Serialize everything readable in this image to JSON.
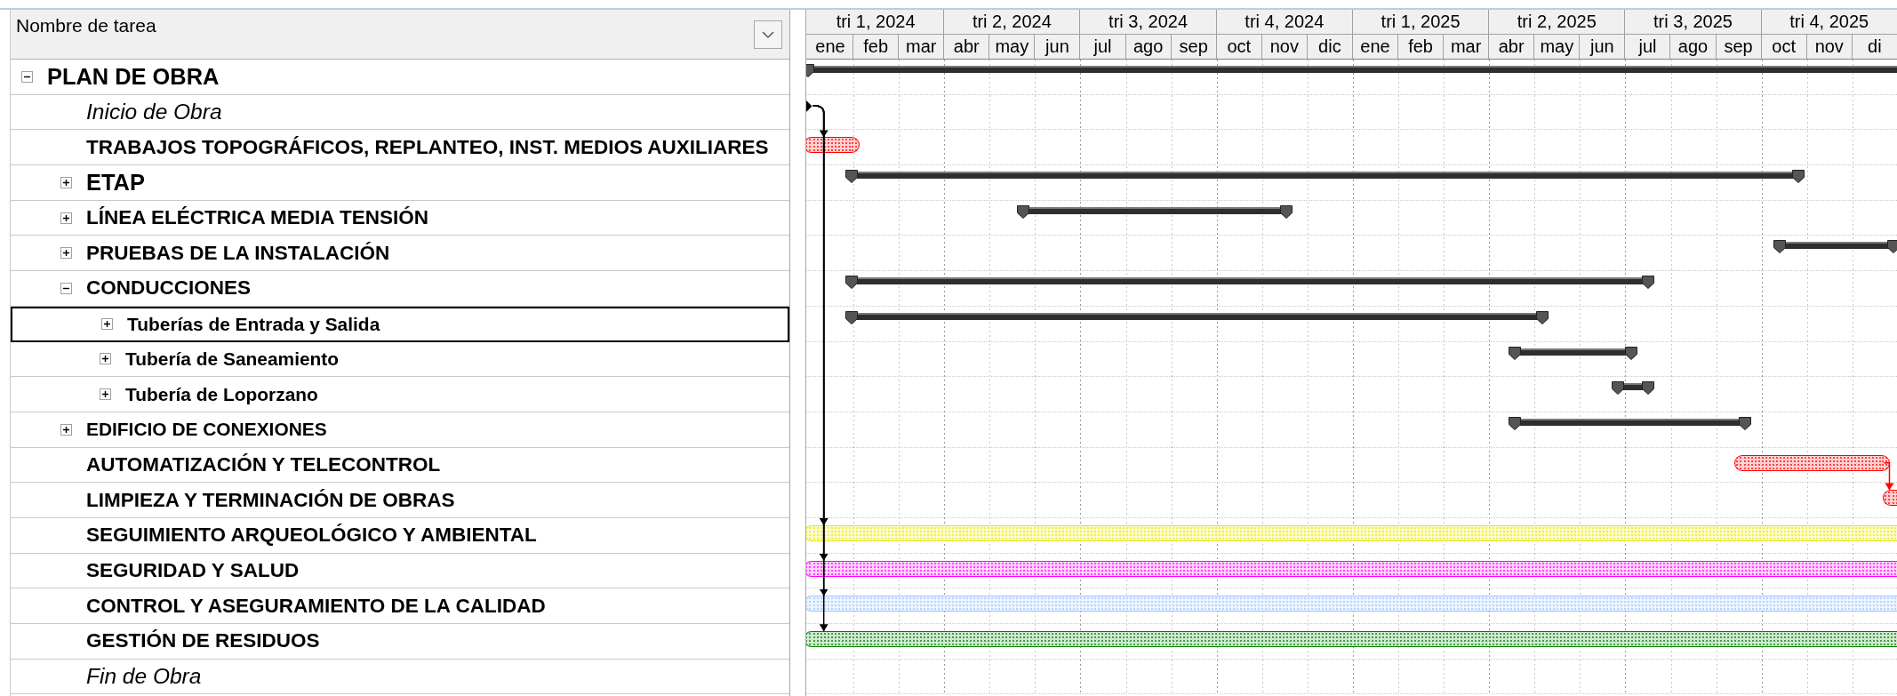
{
  "task_table": {
    "column_header": "Nombre de tarea",
    "tasks": [
      {
        "name": "PLAN DE OBRA",
        "kind": "summary",
        "large": true,
        "small": false,
        "selected": false,
        "expanded": true,
        "bar": {
          "start": {
            "level": 0.002
          }
        },
        "children": [
          {
            "name": "Inicio de Obra",
            "kind": "milestone",
            "large": false,
            "small": false,
            "selected": false,
            "bar": {
              "start": {
                "level": 0.003
              }
            }
          },
          {
            "name": "TRABAJOS TOPOGRÁFICOS, REPLANTEO, INST. MEDIOS AUXILIARES",
            "kind": "task",
            "large": false,
            "small": false,
            "selected": false,
            "bar": {
              "start": {
                "level": 0.002
              },
              "end": {
                "level": 0.0446
              },
              "color": "#ff0000",
              "link_from_start": true,
              "link_from_previous": false
            }
          },
          {
            "name": "ETAP",
            "kind": "summary",
            "large": true,
            "small": false,
            "selected": false,
            "expanded": false,
            "bar": {
              "start": {
                "level": 0.0419
              },
              "end": {
                "level": 0.9086
              }
            }
          },
          {
            "name": "LÍNEA ELÉCTRICA MEDIA TENSIÓN",
            "kind": "summary",
            "large": false,
            "small": false,
            "selected": false,
            "expanded": false,
            "bar": {
              "start": {
                "level": 0.1985
              },
              "end": {
                "level": 0.4398
              }
            }
          },
          {
            "name": "PRUEBAS DE LA INSTALACIÓN",
            "kind": "summary",
            "large": false,
            "small": false,
            "selected": false,
            "expanded": false,
            "bar": {
              "start": {
                "level": 0.8919
              },
              "end": {
                "level": 0.9959
              }
            }
          },
          {
            "name": "CONDUCCIONES",
            "kind": "summary",
            "large": false,
            "small": false,
            "selected": false,
            "expanded": true,
            "bar": {
              "start": {
                "level": 0.0419
              },
              "end": {
                "level": 0.7713
              }
            },
            "children": [
              {
                "name": "Tuberías de Entrada y Salida",
                "kind": "summary",
                "large": false,
                "small": true,
                "selected": true,
                "expanded": false,
                "bar": {
                  "start": {
                    "level": 0.0419
                  },
                  "end": {
                    "level": 0.6743
                  }
                }
              },
              {
                "name": "Tubería de Saneamiento",
                "kind": "summary",
                "large": false,
                "small": true,
                "selected": false,
                "expanded": false,
                "bar": {
                  "start": {
                    "level": 0.6493
                  },
                  "end": {
                    "level": 0.756
                  }
                }
              },
              {
                "name": "Tubería de Loporzano",
                "kind": "summary",
                "large": false,
                "small": true,
                "selected": false,
                "expanded": false,
                "bar": {
                  "start": {
                    "level": 0.7436
                  },
                  "end": {
                    "level": 0.7713
                  }
                }
              }
            ]
          },
          {
            "name": "EDIFICIO DE CONEXIONES",
            "kind": "summary",
            "large": false,
            "small": true,
            "selected": false,
            "expanded": false,
            "bar": {
              "start": {
                "level": 0.6493
              },
              "end": {
                "level": 0.8601
              }
            }
          },
          {
            "name": "AUTOMATIZACIÓN Y TELECONTROL",
            "kind": "task",
            "large": false,
            "small": false,
            "selected": false,
            "bar": {
              "start": {
                "level": 0.8545
              },
              "end": {
                "level": 0.989
              },
              "color": "#ff0000",
              "link_from_start": false,
              "link_from_previous": false
            }
          },
          {
            "name": "LIMPIEZA Y TERMINACIÓN DE OBRAS",
            "kind": "task",
            "large": false,
            "small": false,
            "selected": false,
            "bar": {
              "start": {
                "level": 0.9904
              },
              "color": "#ff0000",
              "link_from_start": false,
              "link_from_previous": true
            }
          },
          {
            "name": "SEGUIMIENTO ARQUEOLÓGICO Y AMBIENTAL",
            "kind": "task",
            "large": false,
            "small": false,
            "selected": false,
            "bar": {
              "start": {
                "level": 0.002
              },
              "color": "#e6e600",
              "link_from_start": true,
              "link_from_previous": false
            }
          },
          {
            "name": "SEGURIDAD Y SALUD",
            "kind": "task",
            "large": false,
            "small": false,
            "selected": false,
            "bar": {
              "start": {
                "level": 0.002
              },
              "color": "#ff00ff",
              "link_from_start": true,
              "link_from_previous": false
            }
          },
          {
            "name": "CONTROL Y ASEGURAMIENTO DE LA CALIDAD",
            "kind": "task",
            "large": false,
            "small": false,
            "selected": false,
            "bar": {
              "start": {
                "level": 0.002
              },
              "color": "#99c2ff",
              "link_from_start": true,
              "link_from_previous": false
            }
          },
          {
            "name": "GESTIÓN DE RESIDUOS",
            "kind": "task",
            "large": false,
            "small": false,
            "selected": false,
            "bar": {
              "start": {
                "level": 0.002
              },
              "color": "#008000",
              "link_from_start": true,
              "link_from_previous": false
            }
          },
          {
            "name": "Fin de Obra",
            "kind": "milestone",
            "large": false,
            "small": false,
            "selected": false
          }
        ]
      }
    ]
  },
  "timescale": {
    "quarters": [
      "tri 1, 2024",
      "tri 2, 2024",
      "tri 3, 2024",
      "tri 4, 2024",
      "tri 1, 2025",
      "tri 2, 2025",
      "tri 3, 2025",
      "tri 4, 2025"
    ],
    "months": [
      "ene",
      "feb",
      "mar",
      "abr",
      "may",
      "jun",
      "jul",
      "ago",
      "sep",
      "oct",
      "nov",
      "dic",
      "ene",
      "feb",
      "mar",
      "abr",
      "may",
      "jun",
      "jul",
      "ago",
      "sep",
      "oct",
      "nov",
      "di"
    ]
  }
}
